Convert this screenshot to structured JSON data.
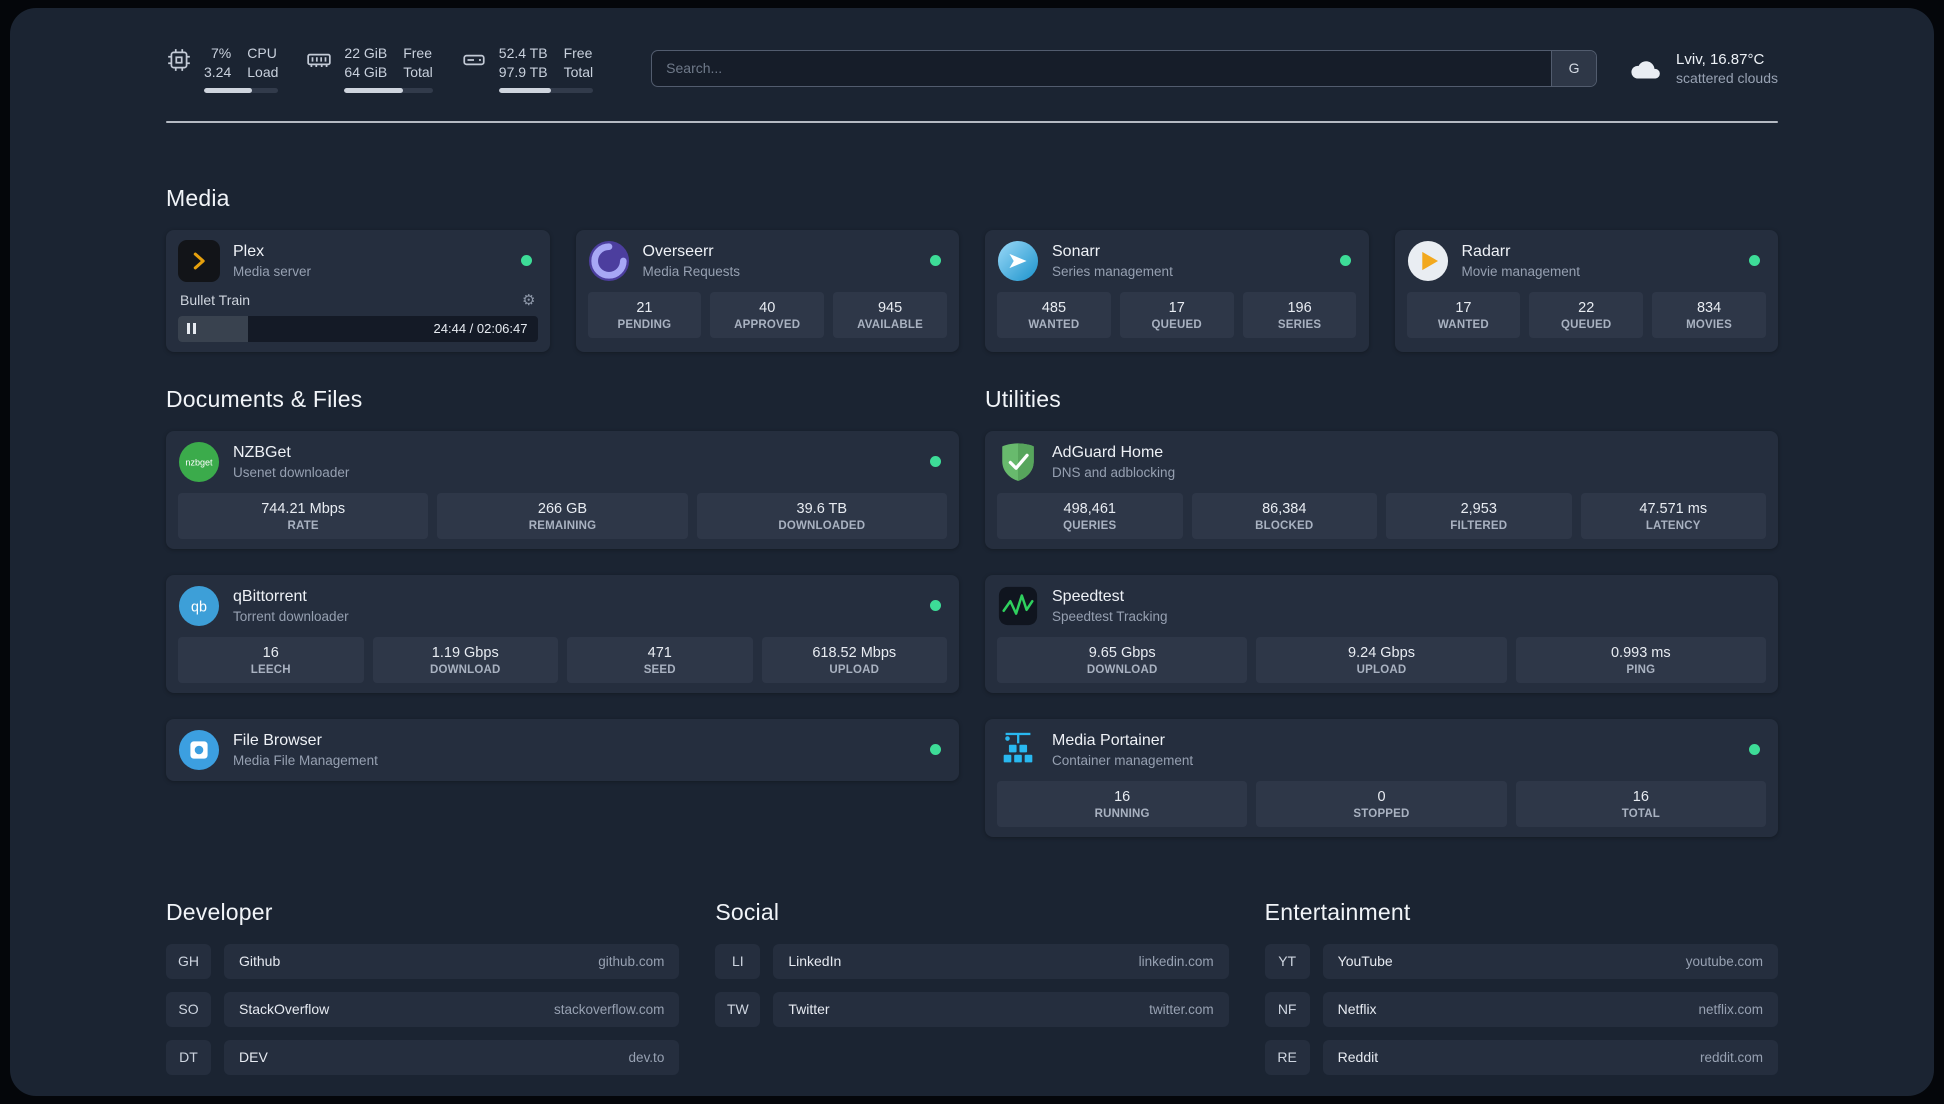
{
  "topbar": {
    "cpu": {
      "usage": "7%",
      "load": "3.24",
      "title": "CPU",
      "subtitle": "Load",
      "progress_percent": 65
    },
    "memory": {
      "free": "22 GiB",
      "total": "64 GiB",
      "free_label": "Free",
      "total_label": "Total",
      "progress_percent": 66
    },
    "disk": {
      "free": "52.4 TB",
      "total": "97.9 TB",
      "free_label": "Free",
      "total_label": "Total",
      "progress_percent": 55
    },
    "search": {
      "placeholder": "Search...",
      "provider_button": "G"
    },
    "weather": {
      "location": "Lviv, 16.87°C",
      "condition": "scattered clouds"
    }
  },
  "sections": {
    "media": {
      "title": "Media",
      "cards": [
        {
          "name": "Plex",
          "description": "Media server",
          "status": "online",
          "icon": "plex-icon",
          "player": {
            "title": "Bullet Train",
            "time": "24:44 / 02:06:47",
            "progress_percent": 19.5
          }
        },
        {
          "name": "Overseerr",
          "description": "Media Requests",
          "status": "online",
          "icon": "overseerr-icon",
          "stats": [
            {
              "value": "21",
              "label": "PENDING"
            },
            {
              "value": "40",
              "label": "APPROVED"
            },
            {
              "value": "945",
              "label": "AVAILABLE"
            }
          ]
        },
        {
          "name": "Sonarr",
          "description": "Series management",
          "status": "online",
          "icon": "sonarr-icon",
          "stats": [
            {
              "value": "485",
              "label": "WANTED"
            },
            {
              "value": "17",
              "label": "QUEUED"
            },
            {
              "value": "196",
              "label": "SERIES"
            }
          ]
        },
        {
          "name": "Radarr",
          "description": "Movie management",
          "status": "online",
          "icon": "radarr-icon",
          "stats": [
            {
              "value": "17",
              "label": "WANTED"
            },
            {
              "value": "22",
              "label": "QUEUED"
            },
            {
              "value": "834",
              "label": "MOVIES"
            }
          ]
        }
      ]
    },
    "documents": {
      "title": "Documents & Files",
      "cards": [
        {
          "name": "NZBGet",
          "description": "Usenet downloader",
          "status": "online",
          "icon": "nzbget-icon",
          "stats": [
            {
              "value": "744.21 Mbps",
              "label": "RATE"
            },
            {
              "value": "266 GB",
              "label": "REMAINING"
            },
            {
              "value": "39.6 TB",
              "label": "DOWNLOADED"
            }
          ]
        },
        {
          "name": "qBittorrent",
          "description": "Torrent downloader",
          "status": "online",
          "icon": "qbittorrent-icon",
          "stats": [
            {
              "value": "16",
              "label": "LEECH"
            },
            {
              "value": "1.19 Gbps",
              "label": "DOWNLOAD"
            },
            {
              "value": "471",
              "label": "SEED"
            },
            {
              "value": "618.52 Mbps",
              "label": "UPLOAD"
            }
          ]
        },
        {
          "name": "File Browser",
          "description": "Media File Management",
          "status": "online",
          "icon": "filebrowser-icon"
        }
      ]
    },
    "utilities": {
      "title": "Utilities",
      "cards": [
        {
          "name": "AdGuard Home",
          "description": "DNS and adblocking",
          "icon": "adguard-icon",
          "stats": [
            {
              "value": "498,461",
              "label": "QUERIES"
            },
            {
              "value": "86,384",
              "label": "BLOCKED"
            },
            {
              "value": "2,953",
              "label": "FILTERED"
            },
            {
              "value": "47.571 ms",
              "label": "LATENCY"
            }
          ]
        },
        {
          "name": "Speedtest",
          "description": "Speedtest Tracking",
          "icon": "speedtest-icon",
          "stats": [
            {
              "value": "9.65 Gbps",
              "label": "DOWNLOAD"
            },
            {
              "value": "9.24 Gbps",
              "label": "UPLOAD"
            },
            {
              "value": "0.993 ms",
              "label": "PING"
            }
          ]
        },
        {
          "name": "Media Portainer",
          "description": "Container management",
          "status": "online",
          "icon": "portainer-icon",
          "stats": [
            {
              "value": "16",
              "label": "RUNNING"
            },
            {
              "value": "0",
              "label": "STOPPED"
            },
            {
              "value": "16",
              "label": "TOTAL"
            }
          ]
        }
      ]
    },
    "developer": {
      "title": "Developer",
      "items": [
        {
          "abbr": "GH",
          "name": "Github",
          "url": "github.com"
        },
        {
          "abbr": "SO",
          "name": "StackOverflow",
          "url": "stackoverflow.com"
        },
        {
          "abbr": "DT",
          "name": "DEV",
          "url": "dev.to"
        }
      ]
    },
    "social": {
      "title": "Social",
      "items": [
        {
          "abbr": "LI",
          "name": "LinkedIn",
          "url": "linkedin.com"
        },
        {
          "abbr": "TW",
          "name": "Twitter",
          "url": "twitter.com"
        }
      ]
    },
    "entertainment": {
      "title": "Entertainment",
      "items": [
        {
          "abbr": "YT",
          "name": "YouTube",
          "url": "youtube.com"
        },
        {
          "abbr": "NF",
          "name": "Netflix",
          "url": "netflix.com"
        },
        {
          "abbr": "RE",
          "name": "Reddit",
          "url": "reddit.com"
        }
      ]
    }
  },
  "colors": {
    "status_online": "#3ddc97",
    "plex_accent": "#e5a00d",
    "divider": "#d0d5dd"
  }
}
